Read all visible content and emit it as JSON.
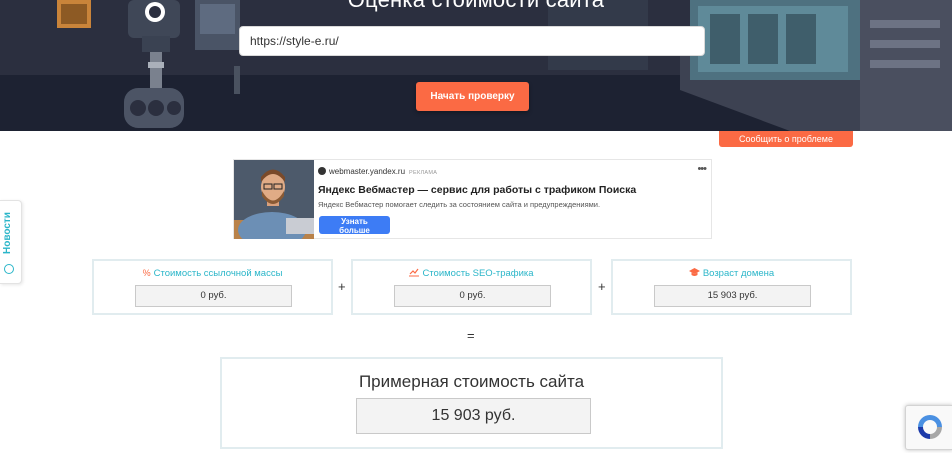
{
  "hero": {
    "title": "Оценка стоимости сайта",
    "url_value": "https://style-e.ru/",
    "start_button": "Начать проверку",
    "report_button": "Сообщить о проблеме"
  },
  "news_tab": {
    "label": "Новости",
    "icon": "clock-icon"
  },
  "ad": {
    "domain": "webmaster.yandex.ru",
    "tag": "РЕКЛАМА",
    "menu": "•••",
    "title": "Яндекс Вебмастер — сервис для работы с трафиком Поиска",
    "description": "Яндекс Вебмастер помогает следить за состоянием сайта и предупреждениями.",
    "cta": "Узнать больше"
  },
  "cards": [
    {
      "label": "Стоимость ссылочной массы",
      "icon": "link-icon",
      "value": "0 руб."
    },
    {
      "label": "Стоимость SEO-трафика",
      "icon": "chart-icon",
      "value": "0 руб."
    },
    {
      "label": "Возраст домена",
      "icon": "graduation-cap-icon",
      "value": "15 903 руб."
    }
  ],
  "operators": {
    "plus": "+",
    "equals": "="
  },
  "result": {
    "title": "Примерная стоимость сайта",
    "value": "15 903 руб."
  },
  "colors": {
    "accent": "#fb6a44",
    "teal": "#2bb6c9",
    "hero_bg": "#2b2f3f",
    "ad_button": "#3d7cf5"
  }
}
